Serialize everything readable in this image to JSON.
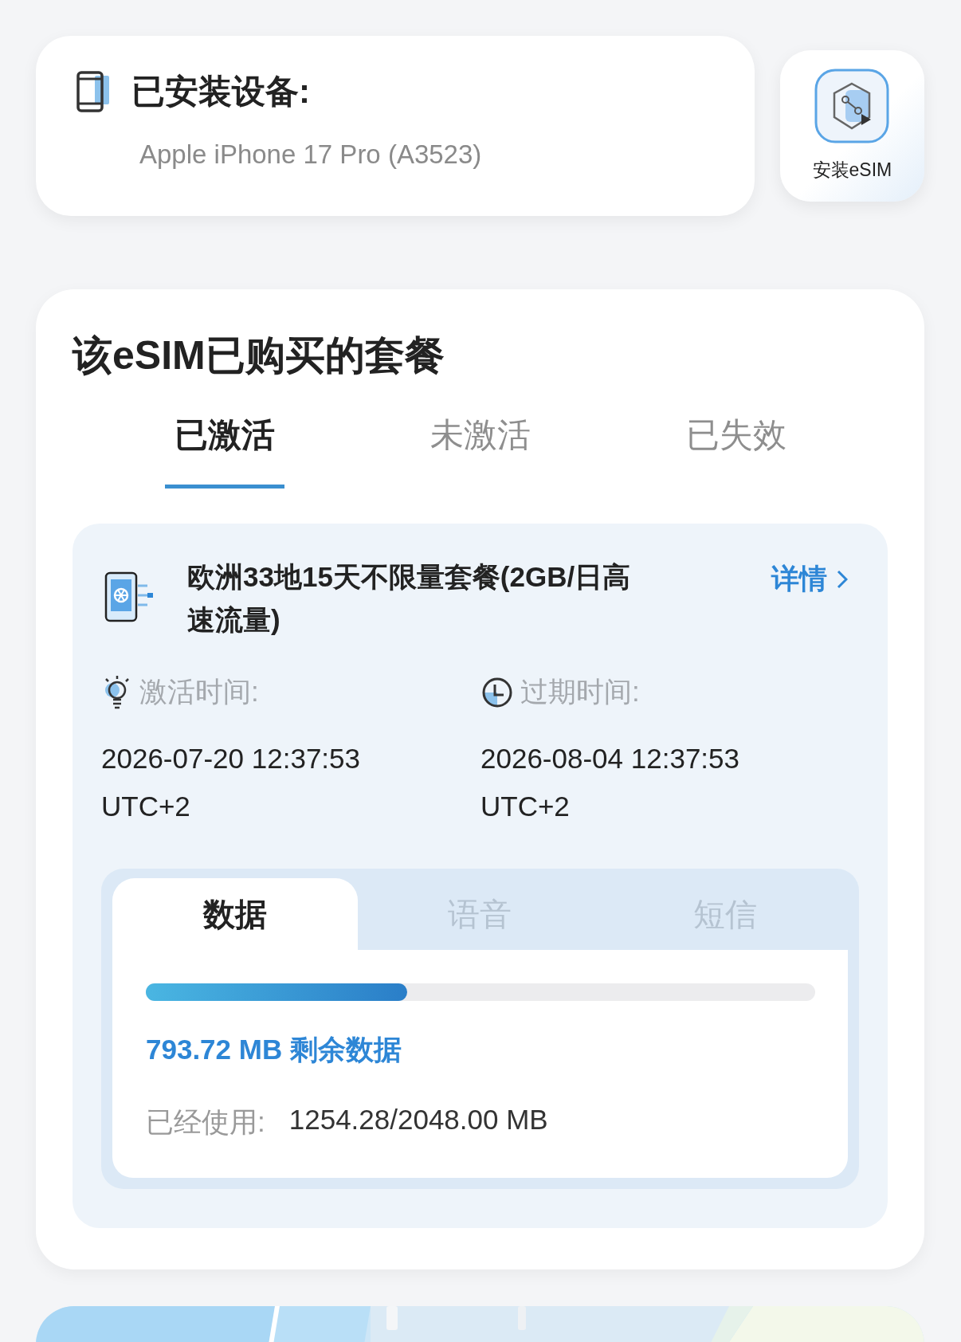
{
  "device": {
    "title": "已安装设备:",
    "model": "Apple iPhone 17 Pro (A3523)"
  },
  "install_button": {
    "label": "安装eSIM"
  },
  "plans": {
    "title": "该eSIM已购买的套餐",
    "tabs": [
      {
        "label": "已激活",
        "selected": true
      },
      {
        "label": "未激活",
        "selected": false
      },
      {
        "label": "已失效",
        "selected": false
      }
    ],
    "plan": {
      "name": "欧洲33地15天不限量套餐(2GB/日高速流量)",
      "details_link": "详情",
      "times": [
        {
          "kind": "activation",
          "label": "激活时间:",
          "value": "2026-07-20 12:37:53 UTC+2"
        },
        {
          "kind": "expiry",
          "label": "过期时间:",
          "value": "2026-08-04 12:37:53 UTC+2"
        }
      ],
      "usage_tabs": [
        {
          "label": "数据",
          "selected": true
        },
        {
          "label": "语音",
          "selected": false
        },
        {
          "label": "短信",
          "selected": false
        }
      ],
      "usage": {
        "level": 0.39,
        "remaining": "793.72 MB 剩余数据",
        "used_label": "已经使用:",
        "used_value": "1254.28/2048.00 MB"
      }
    }
  }
}
